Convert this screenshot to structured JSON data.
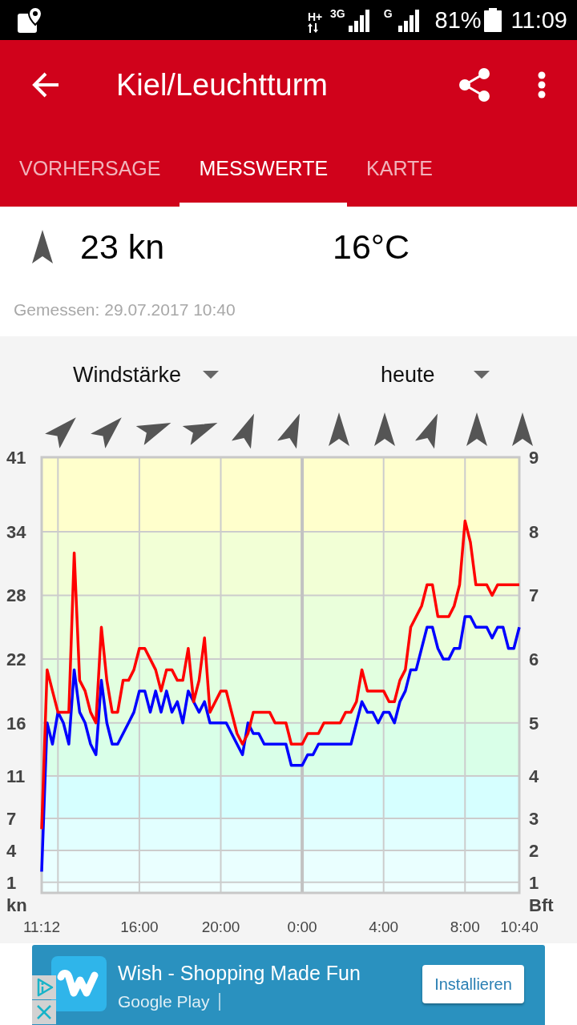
{
  "status_bar": {
    "network_type": "H+",
    "network_primary": "3G",
    "network_secondary": "G",
    "battery": "81%",
    "time": "11:09"
  },
  "app_bar": {
    "title": "Kiel/Leuchtturm"
  },
  "tabs": [
    {
      "label": "VORHERSAGE",
      "selected": false
    },
    {
      "label": "MESSWERTE",
      "selected": true
    },
    {
      "label": "KARTE",
      "selected": false
    }
  ],
  "current": {
    "wind_arrow": {
      "kind": "n"
    },
    "wind": "23 kn",
    "temperature": "16°C",
    "timestamp": "Gemessen: 29.07.2017 10:40"
  },
  "chart_panel": {
    "parameter": "Windstärke",
    "period": "heute",
    "wind_directions": [
      {
        "kind": "ne"
      },
      {
        "kind": "ne"
      },
      {
        "kind": "ene"
      },
      {
        "kind": "ene"
      },
      {
        "kind": "nne"
      },
      {
        "kind": "nne"
      },
      {
        "kind": "n"
      },
      {
        "kind": "n"
      },
      {
        "kind": "nne"
      },
      {
        "kind": "n"
      },
      {
        "kind": "n"
      }
    ],
    "right_axis": {
      "label": "Bft",
      "ticks": [
        "9",
        "8",
        "7",
        "6",
        "5",
        "4",
        "3",
        "2",
        "1"
      ]
    },
    "chart_data": {
      "type": "line",
      "ylabel": "kn",
      "ylim": [
        0,
        41
      ],
      "yticks": [
        1,
        4,
        7,
        11,
        16,
        22,
        28,
        34,
        41
      ],
      "grid": true,
      "bands": [
        {
          "axis": "y",
          "from": 34,
          "to": 41,
          "color": "#ffffcc"
        },
        {
          "axis": "y",
          "from": 28,
          "to": 34,
          "color": "#f2ffd6"
        },
        {
          "axis": "y",
          "from": 22,
          "to": 28,
          "color": "#eaffdb"
        },
        {
          "axis": "y",
          "from": 16,
          "to": 22,
          "color": "#e2ffe0"
        },
        {
          "axis": "y",
          "from": 11,
          "to": 16,
          "color": "#d9ffe8"
        },
        {
          "axis": "y",
          "from": 7,
          "to": 11,
          "color": "#d6ffff"
        },
        {
          "axis": "y",
          "from": 4,
          "to": 7,
          "color": "#e2ffff"
        },
        {
          "axis": "y",
          "from": 1,
          "to": 4,
          "color": "#eaffff"
        },
        {
          "axis": "y",
          "from": 0,
          "to": 1,
          "color": "#f0ffff"
        }
      ],
      "ref_lines": [
        {
          "axis": "x",
          "value": "2017-07-29 00:00"
        }
      ],
      "xlim": [
        "2017-07-28 11:12",
        "2017-07-29 10:40"
      ],
      "xticks": [
        {
          "value": "2017-07-28 11:12",
          "label": "11:12"
        },
        {
          "value": "2017-07-28 16:00",
          "label": "16:00"
        },
        {
          "value": "2017-07-28 20:00",
          "label": "20:00"
        },
        {
          "value": "2017-07-29 00:00",
          "label": "0:00"
        },
        {
          "value": "2017-07-29 04:00",
          "label": "4:00"
        },
        {
          "value": "2017-07-29 08:00",
          "label": "8:00"
        },
        {
          "value": "2017-07-29 10:40",
          "label": "10:40"
        }
      ],
      "x": [
        "2017-07-28 11:12",
        "2017-07-28 11:28",
        "2017-07-28 11:44",
        "2017-07-28 12:00",
        "2017-07-28 12:16",
        "2017-07-28 12:32",
        "2017-07-28 12:48",
        "2017-07-28 13:04",
        "2017-07-28 13:20",
        "2017-07-28 13:36",
        "2017-07-28 13:52",
        "2017-07-28 14:08",
        "2017-07-28 14:24",
        "2017-07-28 14:40",
        "2017-07-28 14:56",
        "2017-07-28 15:12",
        "2017-07-28 15:28",
        "2017-07-28 15:44",
        "2017-07-28 16:00",
        "2017-07-28 16:16",
        "2017-07-28 16:32",
        "2017-07-28 16:48",
        "2017-07-28 17:04",
        "2017-07-28 17:20",
        "2017-07-28 17:36",
        "2017-07-28 17:52",
        "2017-07-28 18:08",
        "2017-07-28 18:24",
        "2017-07-28 18:40",
        "2017-07-28 18:56",
        "2017-07-28 19:12",
        "2017-07-28 19:28",
        "2017-07-28 19:44",
        "2017-07-28 20:00",
        "2017-07-28 20:16",
        "2017-07-28 20:32",
        "2017-07-28 20:48",
        "2017-07-28 21:04",
        "2017-07-28 21:20",
        "2017-07-28 21:36",
        "2017-07-28 21:52",
        "2017-07-28 22:08",
        "2017-07-28 22:24",
        "2017-07-28 22:40",
        "2017-07-28 22:56",
        "2017-07-28 23:12",
        "2017-07-28 23:28",
        "2017-07-28 23:44",
        "2017-07-29 00:00",
        "2017-07-29 00:16",
        "2017-07-29 00:32",
        "2017-07-29 00:48",
        "2017-07-29 01:04",
        "2017-07-29 01:20",
        "2017-07-29 01:36",
        "2017-07-29 01:52",
        "2017-07-29 02:08",
        "2017-07-29 02:24",
        "2017-07-29 02:40",
        "2017-07-29 02:56",
        "2017-07-29 03:12",
        "2017-07-29 03:28",
        "2017-07-29 03:44",
        "2017-07-29 04:00",
        "2017-07-29 04:16",
        "2017-07-29 04:32",
        "2017-07-29 04:48",
        "2017-07-29 05:04",
        "2017-07-29 05:20",
        "2017-07-29 05:36",
        "2017-07-29 05:52",
        "2017-07-29 06:08",
        "2017-07-29 06:24",
        "2017-07-29 06:40",
        "2017-07-29 06:56",
        "2017-07-29 07:12",
        "2017-07-29 07:28",
        "2017-07-29 07:44",
        "2017-07-29 08:00",
        "2017-07-29 08:16",
        "2017-07-29 08:32",
        "2017-07-29 08:48",
        "2017-07-29 09:04",
        "2017-07-29 09:20",
        "2017-07-29 09:36",
        "2017-07-29 09:52",
        "2017-07-29 10:08",
        "2017-07-29 10:24",
        "2017-07-29 10:40"
      ],
      "series": [
        {
          "color": "#0000ff",
          "values": [
            2,
            16,
            14,
            17,
            16,
            14,
            21,
            17,
            16,
            14,
            13,
            20,
            16,
            14,
            14,
            15,
            16,
            17,
            19,
            19,
            17,
            19,
            17,
            19,
            17,
            18,
            16,
            19,
            18,
            17,
            18,
            16,
            16,
            16,
            16,
            15,
            14,
            13,
            16,
            15,
            15,
            14,
            14,
            14,
            14,
            14,
            12,
            12,
            12,
            13,
            13,
            14,
            14,
            14,
            14,
            14,
            14,
            14,
            16,
            18,
            17,
            17,
            16,
            17,
            17,
            16,
            18,
            19,
            21,
            21,
            23,
            25,
            25,
            23,
            22,
            22,
            23,
            23,
            26,
            26,
            25,
            25,
            25,
            24,
            25,
            25,
            23,
            23,
            25
          ]
        },
        {
          "color": "#ff0000",
          "values": [
            6,
            21,
            19,
            17,
            17,
            17,
            32,
            20,
            19,
            17,
            16,
            25,
            20,
            17,
            17,
            20,
            20,
            21,
            23,
            23,
            22,
            21,
            19,
            21,
            21,
            20,
            20,
            23,
            18,
            20,
            24,
            17,
            18,
            19,
            19,
            17,
            15,
            14,
            15,
            17,
            17,
            17,
            17,
            16,
            16,
            16,
            14,
            14,
            14,
            15,
            15,
            15,
            16,
            16,
            16,
            16,
            17,
            17,
            18,
            21,
            19,
            19,
            19,
            19,
            18,
            18,
            20,
            21,
            25,
            26,
            27,
            29,
            29,
            26,
            26,
            26,
            27,
            29,
            35,
            33,
            29,
            29,
            29,
            28,
            29,
            29,
            29,
            29,
            29
          ]
        }
      ]
    }
  },
  "ad": {
    "title": "Wish - Shopping Made Fun",
    "store": "Google Play",
    "button": "Installieren"
  }
}
